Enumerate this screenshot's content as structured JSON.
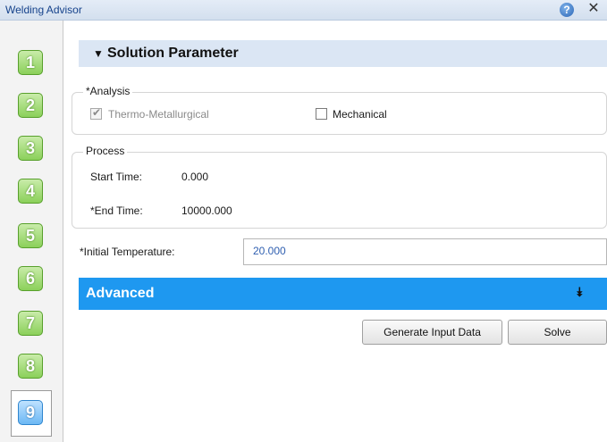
{
  "window": {
    "title": "Welding Advisor"
  },
  "steps": [
    "1",
    "2",
    "3",
    "4",
    "5",
    "6",
    "7",
    "8",
    "9"
  ],
  "active_step": "9",
  "section": {
    "title": "Solution Parameter"
  },
  "analysis": {
    "legend": "*Analysis",
    "thermo_label": "Thermo-Metallurgical",
    "thermo_checked": true,
    "mechanical_label": "Mechanical",
    "mechanical_checked": false
  },
  "process": {
    "legend": "Process",
    "start_label": "Start Time:",
    "start_value": "0.000",
    "end_label": "*End Time:",
    "end_value": "10000.000"
  },
  "initial_temperature": {
    "label": "*Initial Temperature:",
    "value": "20.000"
  },
  "advanced": {
    "label": "Advanced"
  },
  "buttons": {
    "generate": "Generate Input Data",
    "solve": "Solve"
  },
  "colors": {
    "accent": "#1e98f0",
    "step_green": "#8bd05a",
    "step_active": "#6cb8f4"
  }
}
